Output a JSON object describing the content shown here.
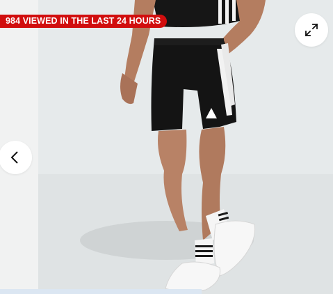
{
  "badge": {
    "text": "984 VIEWED IN THE LAST 24 HOURS",
    "color": "#d10e0e"
  },
  "controls": {
    "expand_icon": "expand-arrows-icon",
    "prev_icon": "chevron-left-icon"
  },
  "image": {
    "subject": "shorts-product-photo",
    "background": "#e7ebec"
  }
}
